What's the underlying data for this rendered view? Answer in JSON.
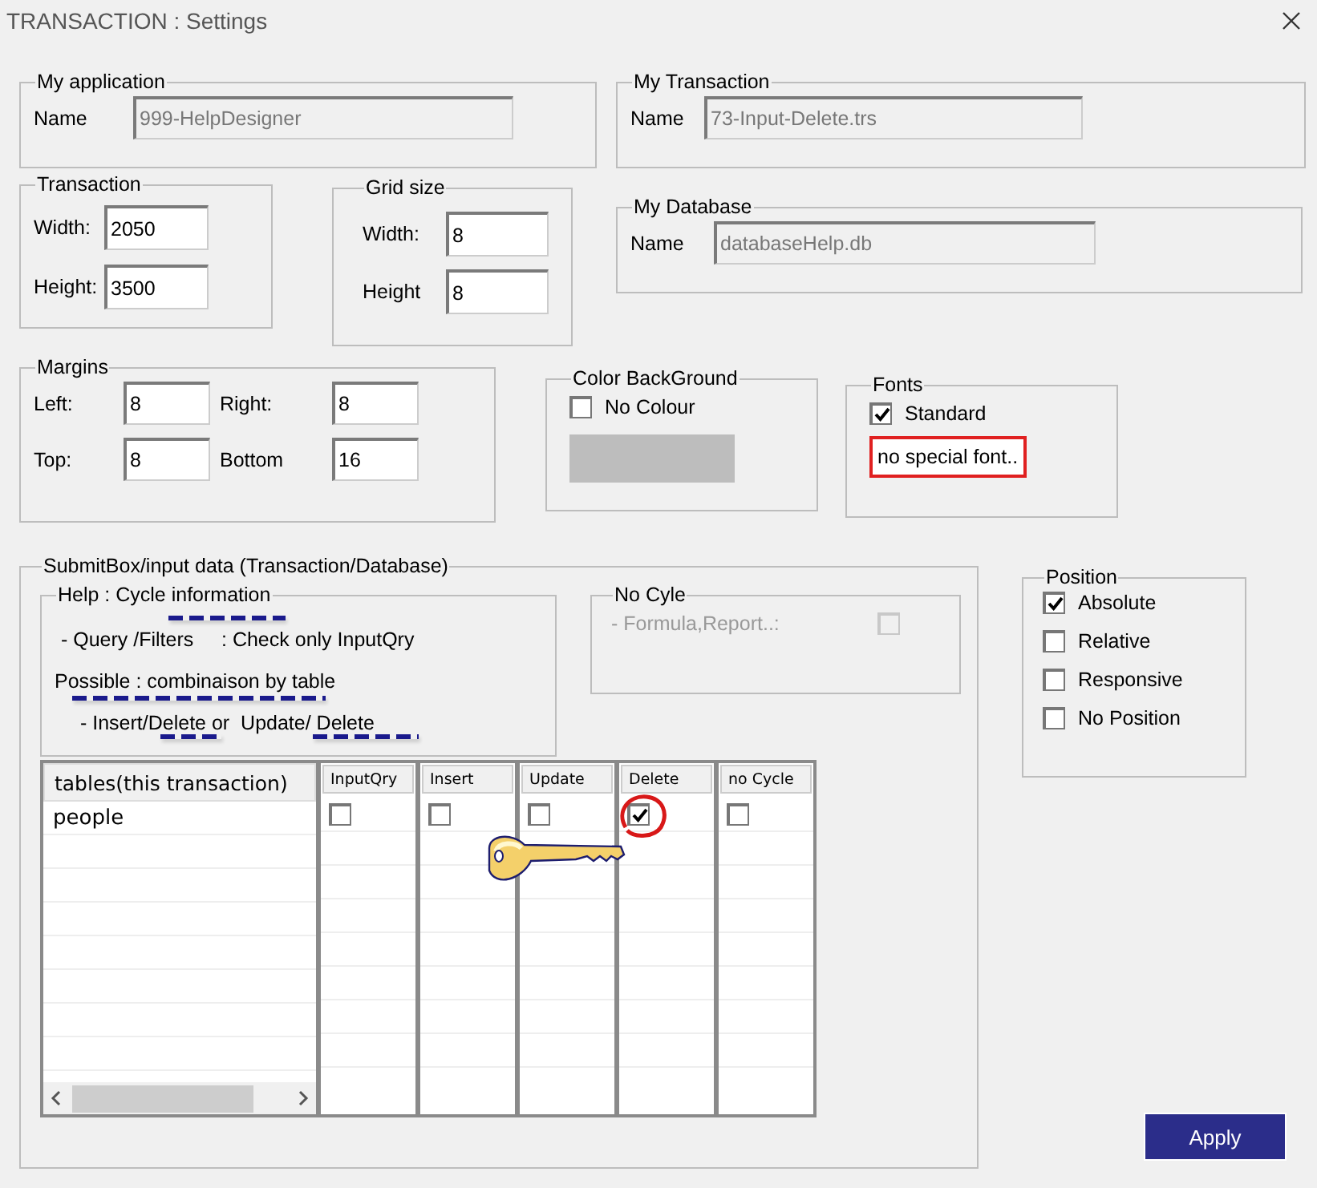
{
  "window": {
    "title": "TRANSACTION : Settings"
  },
  "my_application": {
    "legend": "My application",
    "name_label": "Name",
    "name_value": "999-HelpDesigner"
  },
  "my_transaction": {
    "legend": "My Transaction",
    "name_label": "Name",
    "name_value": "73-Input-Delete.trs"
  },
  "my_database": {
    "legend": "My  Database",
    "name_label": "Name",
    "name_value": "databaseHelp.db"
  },
  "transaction": {
    "legend": "Transaction",
    "fields": [
      {
        "label": "Width:",
        "value": "2050"
      },
      {
        "label": "Height:",
        "value": "3500"
      }
    ]
  },
  "grid_size": {
    "legend": "Grid size",
    "fields": [
      {
        "label": "Width:",
        "value": "8"
      },
      {
        "label": "Height",
        "value": "8"
      }
    ]
  },
  "margins": {
    "legend": "Margins",
    "fields": [
      {
        "label": "Left:",
        "value": "8"
      },
      {
        "label": "Right:",
        "value": "8"
      },
      {
        "label": "Top:",
        "value": "8"
      },
      {
        "label": "Bottom",
        "value": "16"
      }
    ]
  },
  "color_background": {
    "legend": "Color BackGround",
    "no_colour": {
      "label": "No Colour",
      "checked": false
    }
  },
  "fonts": {
    "legend": "Fonts",
    "standard": {
      "label": "Standard",
      "checked": true
    },
    "note": "no special font.."
  },
  "submit_box": {
    "legend": "SubmitBox/input data (Transaction/Database)",
    "help": {
      "legend": "Help : Cycle information",
      "lines": [
        "- Query /Filters     : Check only InputQry",
        "Possible : combinaison by table",
        "- Insert/Delete or  Update/ Delete"
      ]
    },
    "no_cycle": {
      "legend": "No Cyle",
      "label": "- Formula,Report..:",
      "checked": false,
      "disabled": true
    },
    "grid": {
      "table_header": "tables(this transaction)",
      "columns": [
        "InputQry",
        "Insert",
        "Update",
        "Delete",
        "no Cycle"
      ],
      "rows": [
        {
          "table": "people",
          "checks": [
            false,
            false,
            false,
            true,
            false
          ]
        }
      ]
    }
  },
  "position": {
    "legend": "Position",
    "options": [
      {
        "label": "Absolute",
        "checked": true
      },
      {
        "label": "Relative",
        "checked": false
      },
      {
        "label": "Responsive",
        "checked": false
      },
      {
        "label": "No Position",
        "checked": false
      }
    ]
  },
  "apply_button": "Apply"
}
